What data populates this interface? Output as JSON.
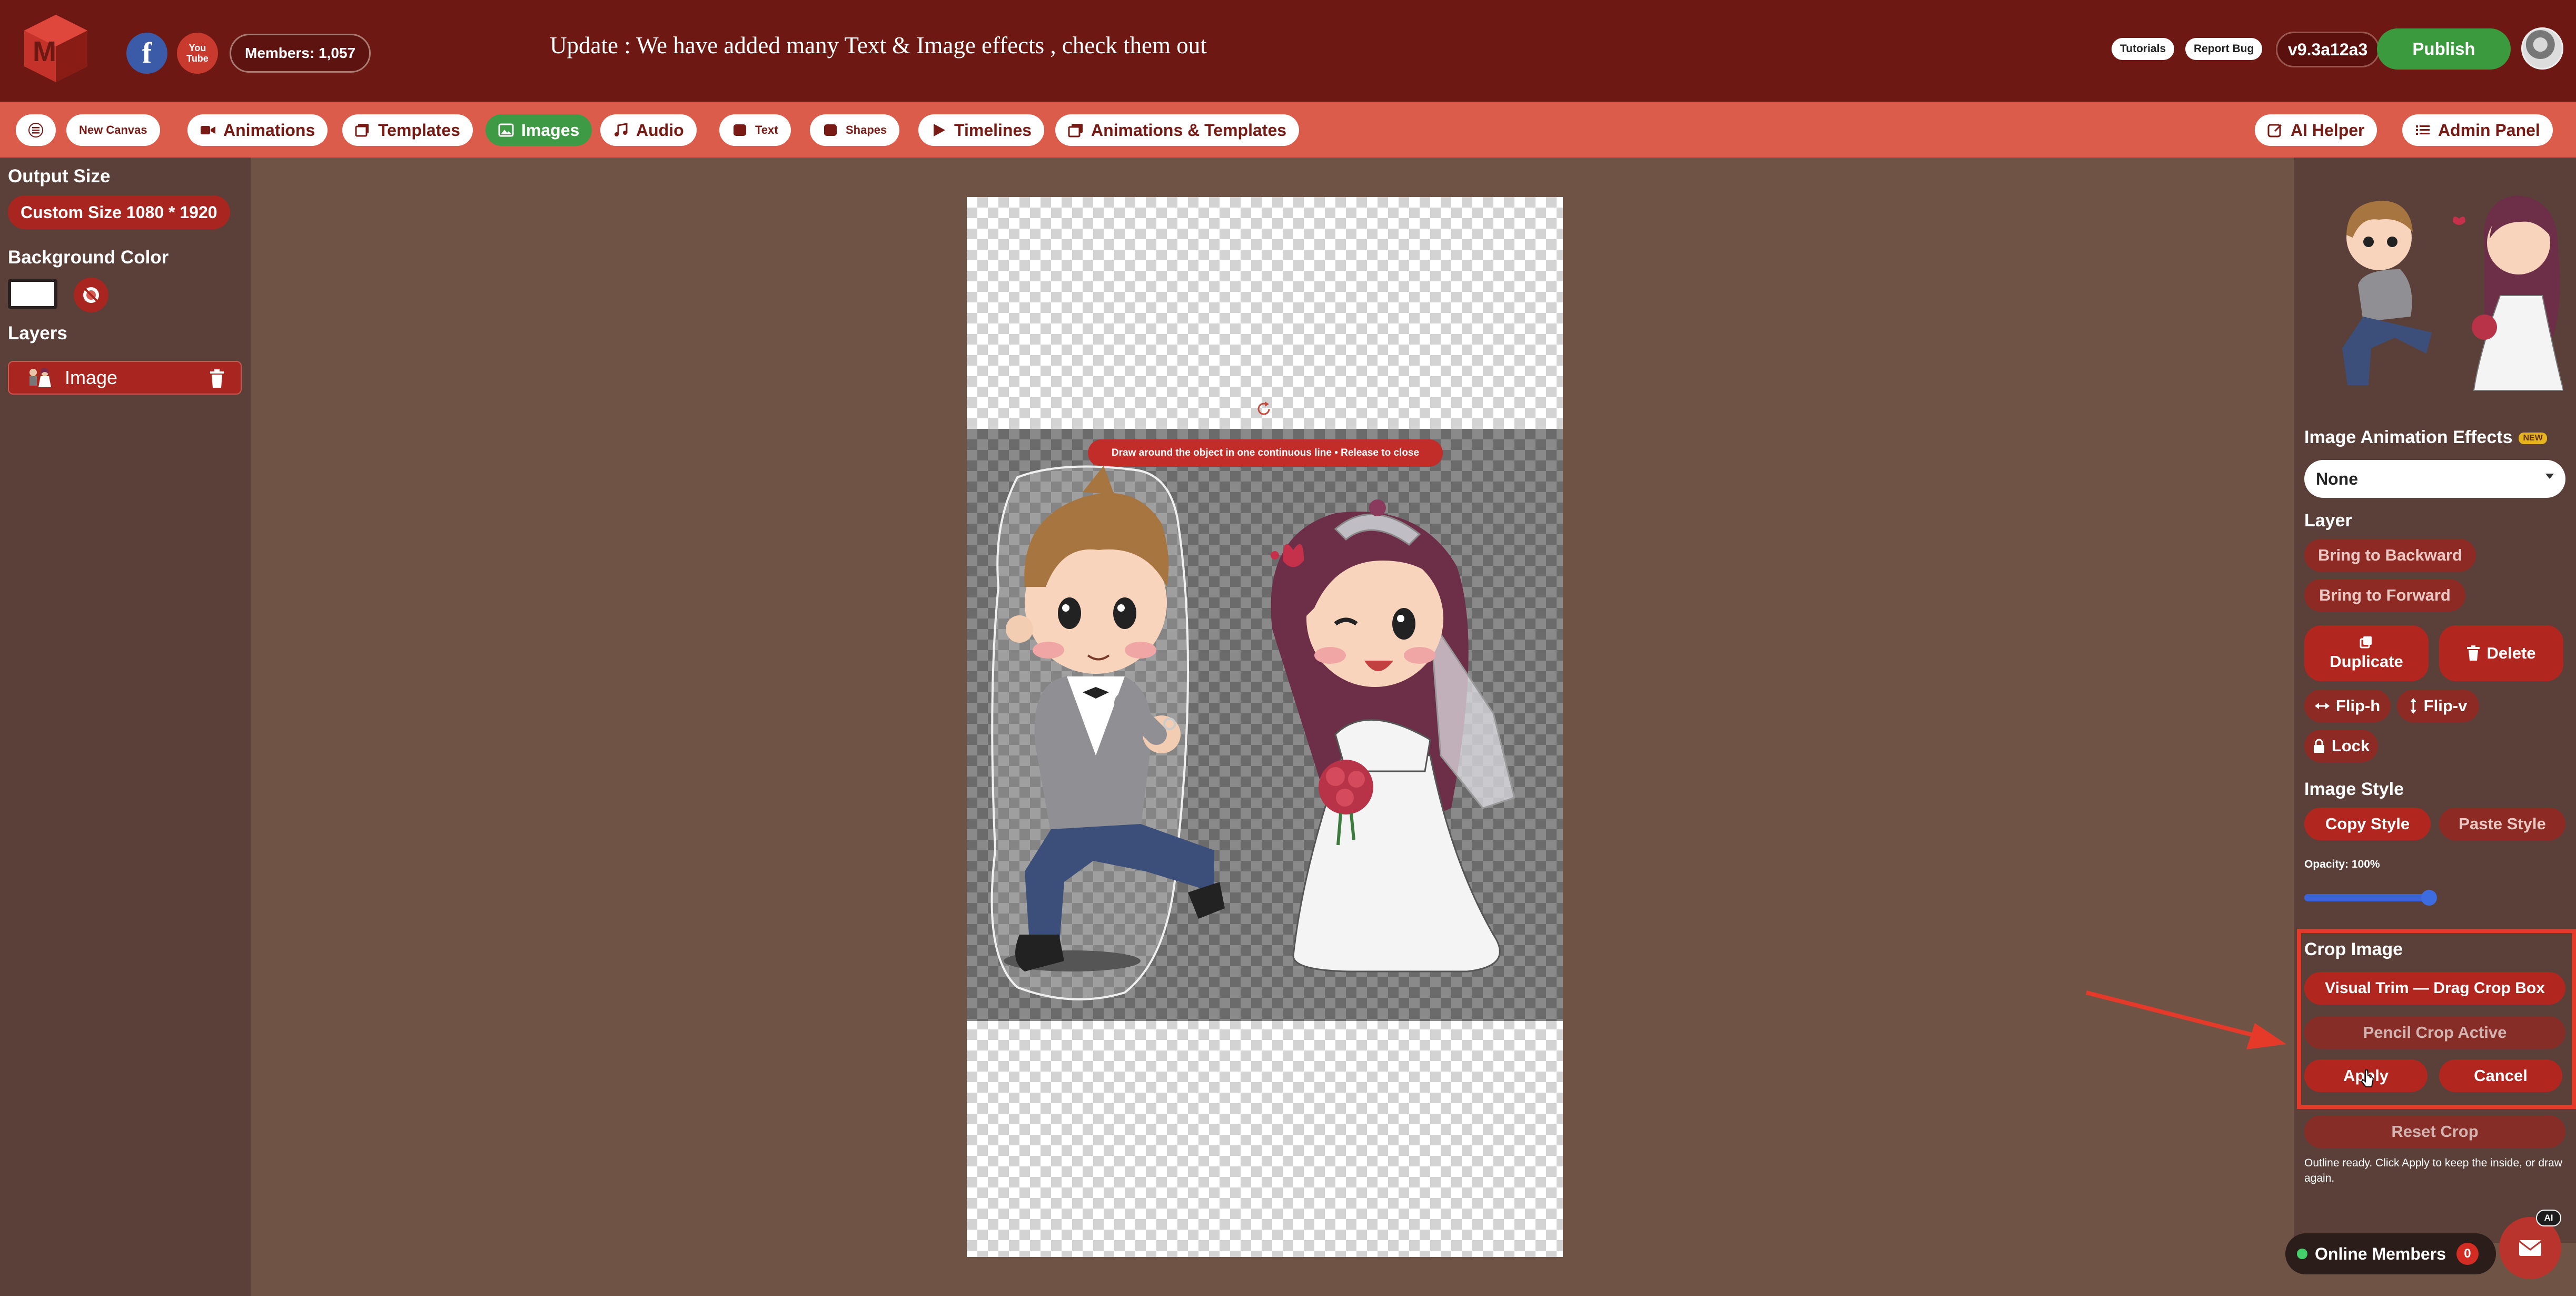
{
  "header": {
    "members": "Members: 1,057",
    "announcement": "Update : We have added many Text & Image effects , check them out",
    "tutorials_label": "Tutorials",
    "report_bug_label": "Report Bug",
    "version": "v9.3a12a3",
    "publish_label": "Publish",
    "facebook_glyph": "f",
    "youtube_line1": "You",
    "youtube_line2": "Tube"
  },
  "toolbar": {
    "new_canvas": "New Canvas",
    "animations": "Animations",
    "templates": "Templates",
    "images": "Images",
    "audio": "Audio",
    "text": "Text",
    "shapes": "Shapes",
    "timelines": "Timelines",
    "animations_templates": "Animations & Templates",
    "ai_helper": "AI Helper",
    "admin_panel": "Admin Panel"
  },
  "left_panel": {
    "output_size_label": "Output Size",
    "output_size_value": "Custom Size 1080 * 1920",
    "background_color_label": "Background Color",
    "background_color_value": "#ffffff",
    "layers_label": "Layers",
    "layers": [
      {
        "name": "Image"
      }
    ]
  },
  "canvas": {
    "crop_hint": "Draw around the object in one continuous line • Release to close"
  },
  "right_panel": {
    "animation_effects_label": "Image Animation Effects",
    "new_badge": "NEW",
    "animation_effect_value": "None",
    "layer_label": "Layer",
    "bring_backward": "Bring to Backward",
    "bring_forward": "Bring to Forward",
    "duplicate": "Duplicate",
    "delete": "Delete",
    "flip_h": "Flip-h",
    "flip_v": "Flip-v",
    "lock": "Lock",
    "image_style_label": "Image Style",
    "copy_style": "Copy Style",
    "paste_style": "Paste Style",
    "opacity_label": "Opacity: 100%",
    "opacity_value": 1.0,
    "crop_image_label": "Crop Image",
    "visual_trim": "Visual Trim — Drag Crop Box",
    "pencil_crop": "Pencil Crop Active",
    "apply": "Apply",
    "cancel": "Cancel",
    "reset_crop": "Reset Crop",
    "outline_note": "Outline ready. Click Apply to keep the inside, or draw again."
  },
  "footer": {
    "online_members_label": "Online Members",
    "online_count": "0",
    "ai_badge": "AI"
  },
  "colors": {
    "header_bg": "#6e1813",
    "toolbar_bg": "#dc5c4b",
    "workspace_bg": "#6f5446",
    "panel_bg": "#5a4039",
    "accent_red": "#a8261f",
    "active_green": "#3f9a45",
    "highlight_box": "#e53a2a"
  },
  "icons": [
    "app-logo-icon",
    "facebook-icon",
    "youtube-icon",
    "menu-icon",
    "video-icon",
    "templates-icon",
    "image-icon",
    "music-icon",
    "text-icon",
    "shape-icon",
    "play-icon",
    "gallery-icon",
    "ai-helper-icon",
    "list-icon",
    "no-color-icon",
    "trash-icon",
    "rotate-icon",
    "copy-icon",
    "arrows-h-icon",
    "arrows-v-icon",
    "lock-icon",
    "mail-icon",
    "cursor-icon",
    "arrow-annotation"
  ]
}
